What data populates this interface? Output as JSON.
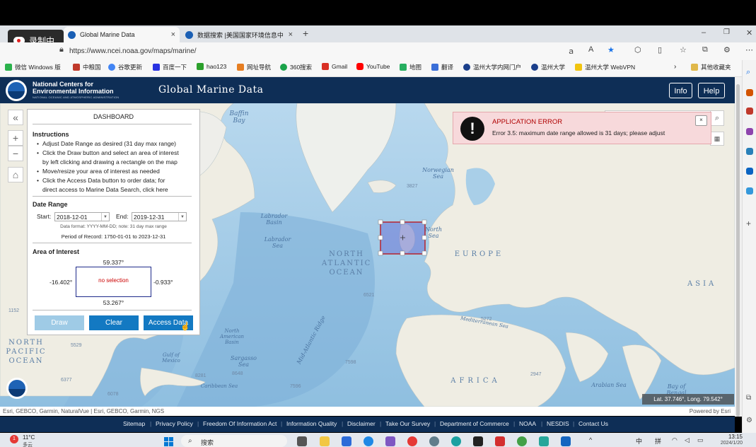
{
  "recording": {
    "label": "录制中"
  },
  "browser": {
    "tabs": [
      {
        "title": "Global Marine Data",
        "close": "×"
      },
      {
        "title": "数据搜索 |美国国家环境信息中心",
        "close": "×"
      }
    ],
    "new_tab": "+",
    "window_controls": {
      "minimize": "–",
      "restore": "❐",
      "close": "✕"
    },
    "url": "https://www.ncei.noaa.gov/maps/marine/",
    "bookmarks": [
      "微信 Windows 版",
      "中粮国",
      "谷歌更新",
      "百度一下",
      "hao123",
      "网址导航",
      "360搜索",
      "Gmail",
      "YouTube",
      "地图",
      "翻译",
      "温州大学内网门户",
      "温州大学",
      "温州大学 WebVPN"
    ],
    "other_bookmarks": "其他收藏夹"
  },
  "header": {
    "org_line1": "National Centers for",
    "org_line2": "Environmental Information",
    "org_sub": "NATIONAL OCEANIC AND ATMOSPHERIC ADMINISTRATION",
    "title": "Global Marine Data",
    "info_btn": "Info",
    "help_btn": "Help"
  },
  "map_controls": {
    "collapse": "«",
    "zoom_in": "+",
    "zoom_out": "−",
    "home": "⌂"
  },
  "dashboard": {
    "title": "DASHBOARD",
    "instructions_head": "Instructions",
    "instructions": [
      "Adjust Date Range as desired (31 day max range)",
      "Click the Draw button and select an area of interest",
      "by left clicking and drawing a rectangle on the map",
      "Move/resize your area of interest as needed",
      "Click the Access Data button to order data; for",
      "direct access to Marine Data Search, click here"
    ],
    "date_range_head": "Date Range",
    "start_label": "Start:",
    "start_value": "2018-12-01",
    "end_label": "End:",
    "end_value": "2019-12-31",
    "date_note": "Data format: YYYY-MM-DD; note: 31 day max range",
    "period": "Period of Record: 1750-01-01 to 2023-12-31",
    "aoi_head": "Area of Interest",
    "north": "59.337°",
    "south": "53.267°",
    "west": "-16.402°",
    "east": "-0.933°",
    "selection_status": "no selection",
    "draw_btn": "Draw",
    "clear_btn": "Clear",
    "access_btn": "Access Data"
  },
  "error": {
    "icon": "!",
    "title": "APPLICATION ERROR",
    "message": "Error 3.5: maximum date range allowed is 31 days; please adjust",
    "close": "×"
  },
  "map": {
    "labels": {
      "baffin": "Baffin Bay",
      "labrador_basin": "Labrador Basin",
      "labrador_sea": "Labrador Sea",
      "norwegian": "Norwegian Sea",
      "north_sea": "North Sea",
      "europe": "EUROPE",
      "asia": "ASIA",
      "africa": "AFRICA",
      "north_atlantic": "NORTH ATLANTIC OCEAN",
      "north_pacific": "NORTH PACIFIC OCEAN",
      "ridge": "Mid-Atlantic Ridge",
      "mediterranean": "Mediterranean Sea",
      "na_basin": "North American Basin",
      "sargasso": "Sargasso Sea",
      "gulf_mexico": "Gulf of Mexico",
      "caribbean": "Caribbean Sea",
      "arabian": "Arabian Sea",
      "bengal": "Bay of Bengal"
    },
    "depths": [
      "3827",
      "6521",
      "5272",
      "7598",
      "5529",
      "6377",
      "6078",
      "8281",
      "8648",
      "7596",
      "2947",
      "1152"
    ],
    "attribution": "Esri, GEBCO, Garmin, NaturalVue | Esri, GEBCO, Garmin, NGS",
    "powered_by": "Powered by Esri",
    "coords": "Lat. 37.746°, Long. 79.542°"
  },
  "footer": {
    "links": [
      "Sitemap",
      "Privacy Policy",
      "Freedom Of Information Act",
      "Information Quality",
      "Disclaimer",
      "Take Our Survey",
      "Department of Commerce",
      "NOAA",
      "NESDIS",
      "Contact Us"
    ]
  },
  "taskbar": {
    "weather_temp": "11°C",
    "weather_desc": "多云",
    "search": "搜索",
    "ime1": "中",
    "ime2": "拼",
    "time": "13:15",
    "date": "2024/1/20"
  }
}
